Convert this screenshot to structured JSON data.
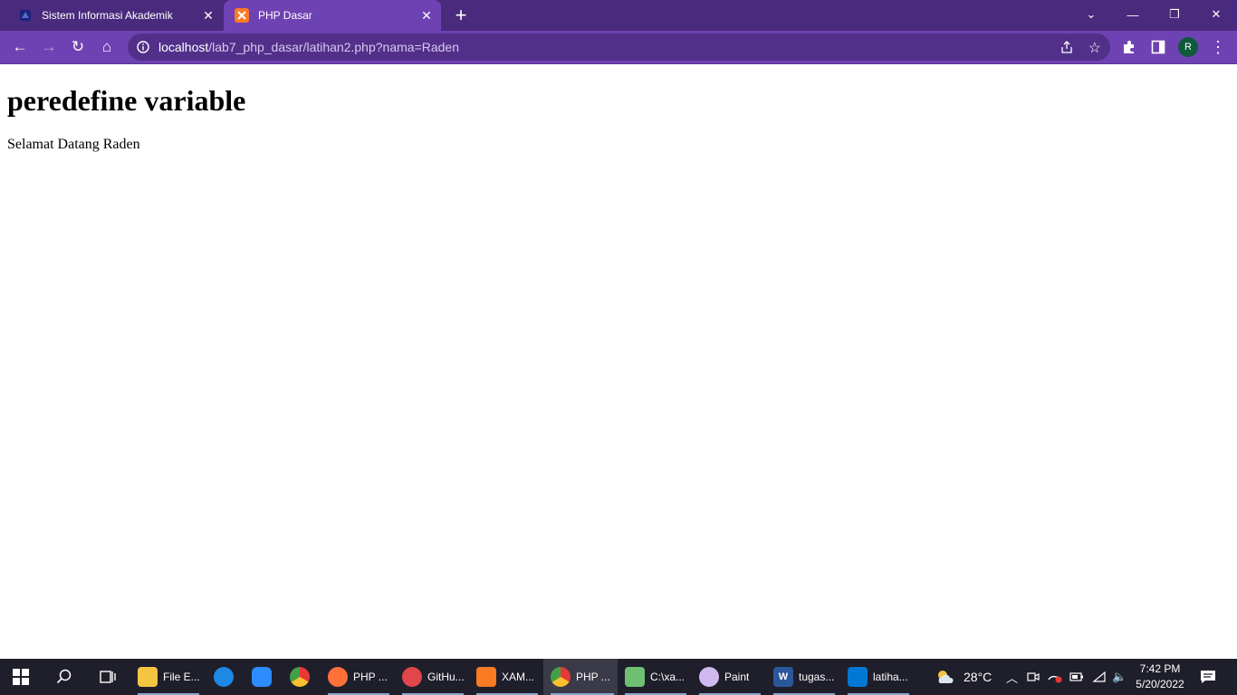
{
  "browser": {
    "tabs": [
      {
        "label": "Sistem Informasi Akademik",
        "icon": "university-logo-icon",
        "active": false
      },
      {
        "label": "PHP Dasar",
        "icon": "xampp-icon",
        "active": true
      }
    ],
    "new_tab": "+",
    "window_controls": {
      "tab_search": "⌄",
      "minimize": "—",
      "restore": "❐",
      "close": "✕"
    },
    "nav": {
      "back": "←",
      "forward": "→",
      "reload": "↻",
      "home": "⌂"
    },
    "address": {
      "host": "localhost",
      "path": "/lab7_php_dasar/latihan2.php?nama=Raden"
    },
    "profile_initial": "R",
    "accent": "#6f42b3"
  },
  "page": {
    "heading": "peredefine variable",
    "text": "Selamat Datang Raden"
  },
  "taskbar": {
    "apps": [
      {
        "label": "File E...",
        "icon": "file-explorer-icon",
        "color": "#f5c542"
      },
      {
        "label": "",
        "icon": "edge-icon",
        "color": "#1e88e5"
      },
      {
        "label": "",
        "icon": "zoom-icon",
        "color": "#2d8cff"
      },
      {
        "label": "",
        "icon": "chrome-icon",
        "color": "#e53935"
      },
      {
        "label": "PHP ...",
        "icon": "firefox-icon",
        "color": "#ff7139"
      },
      {
        "label": "GitHu...",
        "icon": "github-desktop-icon",
        "color": "#e0464a"
      },
      {
        "label": "XAM...",
        "icon": "xampp-icon",
        "color": "#fb7a24"
      },
      {
        "label": "PHP ...",
        "icon": "chrome-profile-icon",
        "color": "#34a853"
      },
      {
        "label": "C:\\xa...",
        "icon": "notepad-icon",
        "color": "#6fbf73"
      },
      {
        "label": "Paint",
        "icon": "paint-icon",
        "color": "#d0b8f0"
      },
      {
        "label": "tugas...",
        "icon": "word-icon",
        "color": "#2b579a"
      },
      {
        "label": "latiha...",
        "icon": "vscode-icon",
        "color": "#0078d4"
      }
    ],
    "weather": "28°C",
    "time": "7:42 PM",
    "date": "5/20/2022"
  }
}
